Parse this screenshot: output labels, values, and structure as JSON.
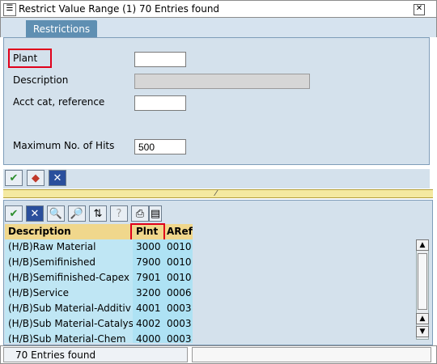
{
  "window": {
    "title": "Restrict Value Range (1)   70 Entries found",
    "close_glyph": "✕",
    "title_icon_glyph": "☰"
  },
  "tabs": [
    {
      "label": "Restrictions"
    }
  ],
  "restrictions": {
    "plant_label": "Plant",
    "plant_value": "",
    "description_label": "Description",
    "description_value": "",
    "acct_label": "Acct cat, reference",
    "acct_value": "",
    "max_hits_label": "Maximum No. of Hits",
    "max_hits_value": "500"
  },
  "toolbar_top": {
    "ok": "✔",
    "filter": "◆",
    "cancel": "✕"
  },
  "toolbar_results": {
    "ok": "✔",
    "cancel": "✕",
    "find": "🔍",
    "find_next": "🔎",
    "sort": "⇅",
    "info": "?",
    "print": "⎙",
    "copy": "▤"
  },
  "splitter": {
    "mark": "⁄"
  },
  "table": {
    "columns": [
      "Description",
      "Plnt",
      "ARef"
    ],
    "rows": [
      {
        "desc": "(H/B)Raw Material",
        "plant": "3000",
        "aref": "0010"
      },
      {
        "desc": "(H/B)Semifinished",
        "plant": "7900",
        "aref": "0010"
      },
      {
        "desc": "(H/B)Semifinished-Capex",
        "plant": "7901",
        "aref": "0010"
      },
      {
        "desc": "(H/B)Service",
        "plant": "3200",
        "aref": "0006"
      },
      {
        "desc": "(H/B)Sub Material-Additiv",
        "plant": "4001",
        "aref": "0003"
      },
      {
        "desc": "(H/B)Sub Material-Catalys",
        "plant": "4002",
        "aref": "0003"
      },
      {
        "desc": "(H/B)Sub Material-Chem",
        "plant": "4000",
        "aref": "0003"
      }
    ]
  },
  "status": {
    "text": "70 Entries found"
  },
  "colors": {
    "tab_active": "#5f8fb2",
    "panel_bg": "#d4e1ec",
    "header_bg": "#f0d78c",
    "row_bg": "#bfe6f4",
    "highlight": "#e0001b"
  }
}
